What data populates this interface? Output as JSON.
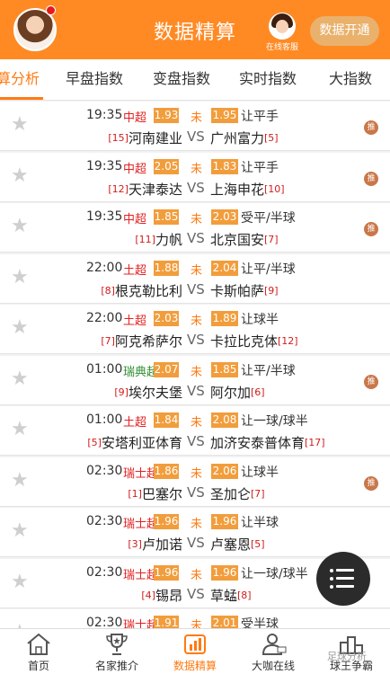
{
  "header": {
    "title": "数据精算",
    "customer_service_label": "在线客服",
    "open_button_label": "数据开通"
  },
  "tabs": [
    {
      "label": "算分析",
      "active": true
    },
    {
      "label": "早盘指数",
      "active": false
    },
    {
      "label": "变盘指数",
      "active": false
    },
    {
      "label": "实时指数",
      "active": false
    },
    {
      "label": "大指数",
      "active": false
    }
  ],
  "matches": [
    {
      "time": "19:35",
      "league": "中超",
      "league_color": "#e12222",
      "odds1": "1.93",
      "status": "未",
      "odds2": "1.95",
      "handicap": "让平手",
      "home_rank": "[15]",
      "home": "河南建业",
      "vs": "VS",
      "away": "广州富力",
      "away_rank": "[5]",
      "tui": "推"
    },
    {
      "time": "19:35",
      "league": "中超",
      "league_color": "#e12222",
      "odds1": "2.05",
      "status": "未",
      "odds2": "1.83",
      "handicap": "让平手",
      "home_rank": "[12]",
      "home": "天津泰达",
      "vs": "VS",
      "away": "上海申花",
      "away_rank": "[10]",
      "tui": "推"
    },
    {
      "time": "19:35",
      "league": "中超",
      "league_color": "#e12222",
      "odds1": "1.85",
      "status": "未",
      "odds2": "2.03",
      "handicap": "受平/半球",
      "home_rank": "[11]",
      "home": "力帆",
      "vs": "VS",
      "away": "北京国安",
      "away_rank": "[7]",
      "tui": "推"
    },
    {
      "time": "22:00",
      "league": "土超",
      "league_color": "#e12222",
      "odds1": "1.88",
      "status": "未",
      "odds2": "2.04",
      "handicap": "让平/半球",
      "home_rank": "[8]",
      "home": "根克勒比利",
      "vs": "VS",
      "away": "卡斯帕萨",
      "away_rank": "[9]",
      "tui": ""
    },
    {
      "time": "22:00",
      "league": "土超",
      "league_color": "#e12222",
      "odds1": "2.03",
      "status": "未",
      "odds2": "1.89",
      "handicap": "让球半",
      "home_rank": "[7]",
      "home": "阿克希萨尔",
      "vs": "VS",
      "away": "卡拉比克体",
      "away_rank": "[12]",
      "tui": ""
    },
    {
      "time": "01:00",
      "league": "瑞典超",
      "league_color": "#2f8f2f",
      "odds1": "2.07",
      "status": "未",
      "odds2": "1.85",
      "handicap": "让平/半球",
      "home_rank": "[9]",
      "home": "埃尔夫堡",
      "vs": "VS",
      "away": "阿尔加",
      "away_rank": "[6]",
      "tui": "推"
    },
    {
      "time": "01:00",
      "league": "土超",
      "league_color": "#e12222",
      "odds1": "1.84",
      "status": "未",
      "odds2": "2.08",
      "handicap": "让一球/球半",
      "home_rank": "[5]",
      "home": "安塔利亚体育",
      "vs": "VS",
      "away": "加济安泰普体育",
      "away_rank": "[17]",
      "tui": ""
    },
    {
      "time": "02:30",
      "league": "瑞士超",
      "league_color": "#e12222",
      "odds1": "1.86",
      "status": "未",
      "odds2": "2.06",
      "handicap": "让球半",
      "home_rank": "[1]",
      "home": "巴塞尔",
      "vs": "VS",
      "away": "圣加仑",
      "away_rank": "[7]",
      "tui": "推"
    },
    {
      "time": "02:30",
      "league": "瑞士超",
      "league_color": "#e12222",
      "odds1": "1.96",
      "status": "未",
      "odds2": "1.96",
      "handicap": "让半球",
      "home_rank": "[3]",
      "home": "卢加诺",
      "vs": "VS",
      "away": "卢塞恩",
      "away_rank": "[5]",
      "tui": ""
    },
    {
      "time": "02:30",
      "league": "瑞士超",
      "league_color": "#e12222",
      "odds1": "1.96",
      "status": "未",
      "odds2": "1.96",
      "handicap": "让一球/球半",
      "home_rank": "[4]",
      "home": "锡昂",
      "vs": "VS",
      "away": "草蜢",
      "away_rank": "[8]",
      "tui": ""
    },
    {
      "time": "02:30",
      "league": "瑞士超",
      "league_color": "#e12222",
      "odds1": "1.91",
      "status": "未",
      "odds2": "2.01",
      "handicap": "受半球",
      "home_rank": "",
      "home": "",
      "vs": "",
      "away": "",
      "away_rank": "",
      "tui": ""
    }
  ],
  "bottom_nav": [
    {
      "label": "首页",
      "icon": "home-icon",
      "active": false
    },
    {
      "label": "名家推介",
      "icon": "trophy-icon",
      "active": false
    },
    {
      "label": "数据精算",
      "icon": "chart-icon",
      "active": true
    },
    {
      "label": "大咖在线",
      "icon": "expert-icon",
      "active": false
    },
    {
      "label": "球王争霸",
      "icon": "ranking-icon",
      "active": false
    }
  ],
  "watermark": "足球分析",
  "colors": {
    "accent": "#ff8a24",
    "odds_bg": "#f29d3c",
    "rank_red": "#d21b1b"
  }
}
